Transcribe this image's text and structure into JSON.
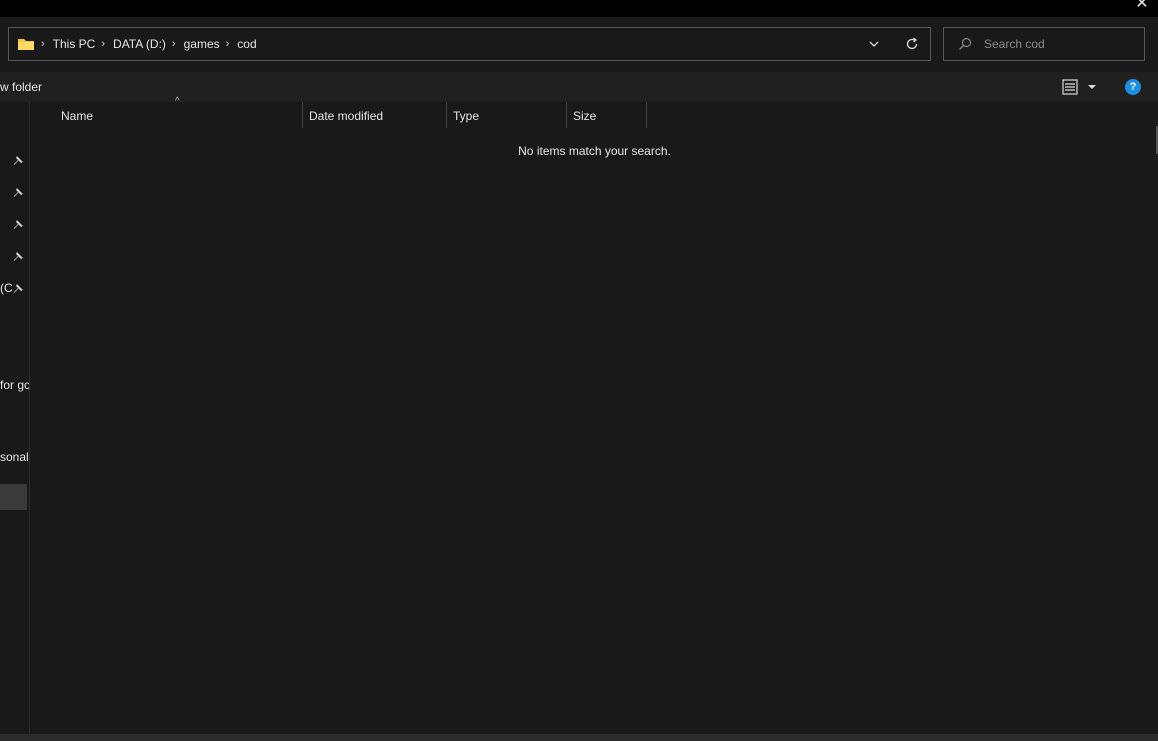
{
  "window": {
    "close_glyph": "✕"
  },
  "address_bar": {
    "folder_icon": "folder-icon",
    "breadcrumbs": [
      "This PC",
      "DATA (D:)",
      "games",
      "cod"
    ],
    "separator_glyph": "›"
  },
  "search": {
    "placeholder": "Search cod",
    "value": ""
  },
  "toolbar": {
    "new_folder_label": "w folder",
    "view_icon": "details-view-icon",
    "help_glyph": "?"
  },
  "nav_pane": {
    "fragments": [
      {
        "text": "(C",
        "pinned": true
      },
      {
        "text": "for gc",
        "pinned": false
      },
      {
        "text": "sonal",
        "pinned": false
      }
    ],
    "pinned_count": 5
  },
  "file_list": {
    "columns": [
      "Name",
      "Date modified",
      "Type",
      "Size"
    ],
    "sorted_column": "Name",
    "sort_glyph": "^",
    "empty_message": "No items match your search."
  },
  "colors": {
    "background": "#191919",
    "titlebar": "#000000",
    "toolbar": "#202020",
    "folder_yellow": "#f5c542",
    "help_blue": "#1a8fe6"
  }
}
